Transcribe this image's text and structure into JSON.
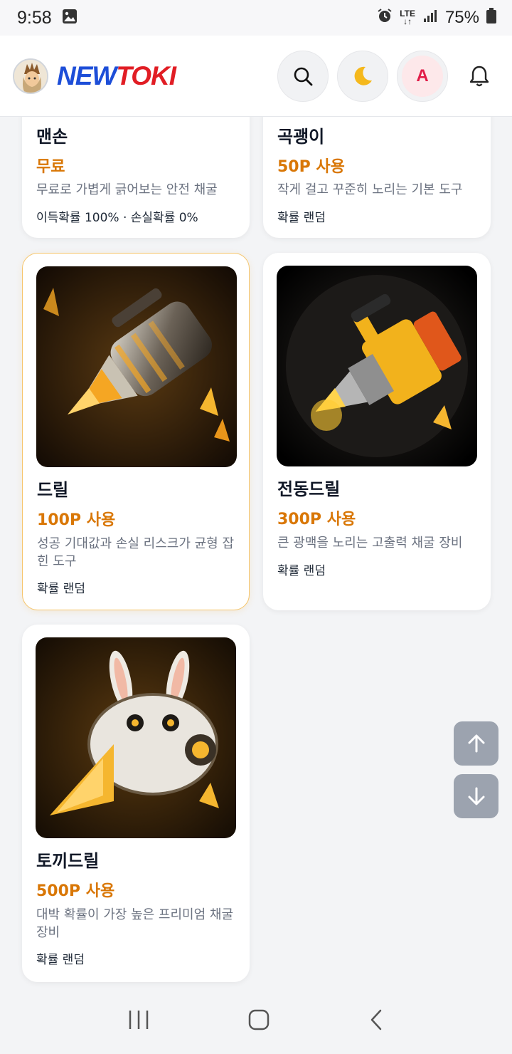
{
  "status_bar": {
    "time": "9:58",
    "network": "LTE",
    "battery": "75%"
  },
  "header": {
    "logo_new": "NEW",
    "logo_toki": "TOKI",
    "avatar_letter": "A"
  },
  "tools": [
    {
      "name": "맨손",
      "price": "무료",
      "desc": "무료로 가볍게 긁어보는 안전 채굴",
      "prob": "이득확률 100% · 손실확률 0%",
      "image": "none-visible"
    },
    {
      "name": "곡괭이",
      "price": "50P 사용",
      "desc": "작게 걸고 꾸준히 노리는 기본 도구",
      "prob": "확률 랜덤",
      "image": "none-visible"
    },
    {
      "name": "드릴",
      "price": "100P 사용",
      "desc": "성공 기대값과 손실 리스크가 균형 잡힌 도구",
      "prob": "확률 랜덤",
      "image": "drill-illustration"
    },
    {
      "name": "전동드릴",
      "price": "300P 사용",
      "desc": "큰 광맥을 노리는 고출력 채굴 장비",
      "prob": "확률 랜덤",
      "image": "power-drill-illustration"
    },
    {
      "name": "토끼드릴",
      "price": "500P 사용",
      "desc": "대박 확률이 가장 높은 프리미엄 채굴 장비",
      "prob": "확률 랜덤",
      "image": "rabbit-drill-illustration"
    }
  ],
  "colors": {
    "price": "#d97706",
    "selected_border": "#f6c56b",
    "logo_blue": "#1d4ed8",
    "logo_red": "#e11d24"
  }
}
